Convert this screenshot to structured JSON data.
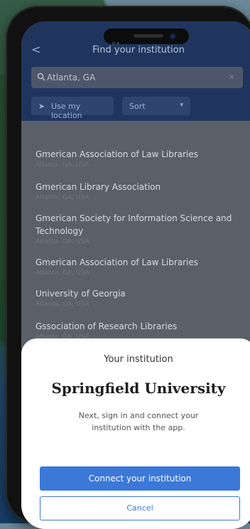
{
  "header": {
    "title": "Find your institution",
    "back": "<"
  },
  "search": {
    "value": "Atlanta, GA"
  },
  "actions": {
    "use_location": "Use my location",
    "sort": "Sort"
  },
  "list": [
    {
      "name": "Gmerican Association of Law Libraries",
      "sub": "Atlanta, GA, USA"
    },
    {
      "name": "Gmerican Library Association",
      "sub": "Atlanta, GA, USA"
    },
    {
      "name": "Gmerican Society for Information Science and Technology",
      "sub": "Atlanta, GA, USA"
    },
    {
      "name": "Gmerican Association of Law Libraries",
      "sub": "Atlanta, GA, USA"
    },
    {
      "name": "University of Georgia",
      "sub": "Atlanta, GA, USA"
    },
    {
      "name": "Gssociation of Research Libraries",
      "sub": "Atlanta, GA, USA"
    }
  ],
  "sheet": {
    "label": "Your institution",
    "institution": "Springfield University",
    "description": "Next, sign in and connect your institution with the app.",
    "primary": "Connect your institution",
    "secondary": "Cancel"
  }
}
